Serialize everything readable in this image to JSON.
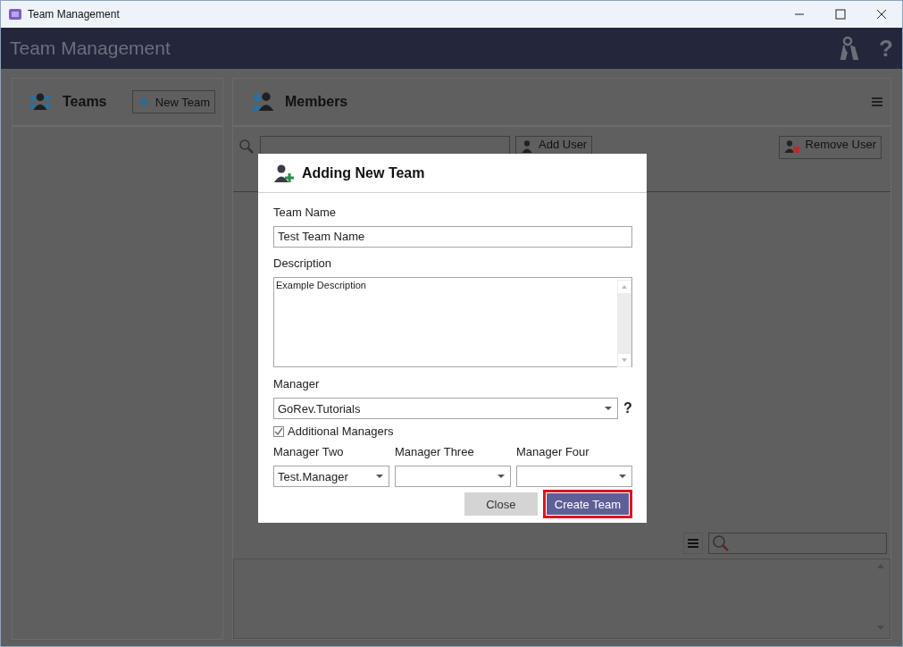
{
  "window": {
    "title": "Team Management"
  },
  "header": {
    "title": "Team Management",
    "help": "?"
  },
  "teams_panel": {
    "title": "Teams",
    "new_button": "New Team"
  },
  "members_panel": {
    "title": "Members",
    "add_button": "Add User",
    "remove_button": "Remove User"
  },
  "dialog": {
    "title": "Adding New Team",
    "team_name": {
      "label": "Team Name",
      "value": "Test Team Name"
    },
    "description": {
      "label": "Description",
      "value": "Example Description"
    },
    "manager": {
      "label": "Manager",
      "value": "GoRev.Tutorials",
      "help": "?"
    },
    "additional_managers": {
      "label": "Additional Managers",
      "checked": true
    },
    "extra_managers": [
      {
        "label": "Manager Two",
        "value": "Test.Manager"
      },
      {
        "label": "Manager Three"
      },
      {
        "label": "Manager Four"
      }
    ],
    "buttons": [
      {
        "label": "Close",
        "kind": "secondary",
        "highlighted": false
      },
      {
        "label": "Create Team",
        "kind": "primary",
        "highlighted": true
      }
    ]
  }
}
